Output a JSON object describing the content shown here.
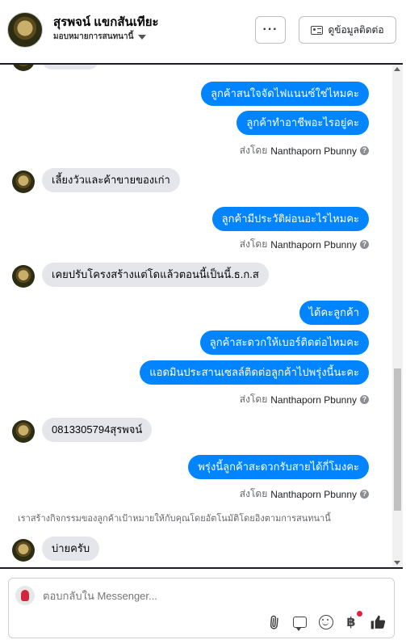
{
  "header": {
    "contact_name": "สุรพจน์ แขกสันเทียะ",
    "assign_label": "มอบหมายการสนทนานี้",
    "more_label": "···",
    "contact_info_label": "ดูข้อมูลติดต่อ"
  },
  "messages": {
    "out_1": "ลูกค้าสนใจจัดไฟแนนซ์ใช่ไหมคะ",
    "out_2": "ลูกค้าทำอาชีพอะไรอยู่คะ",
    "sent_1_prefix": "ส่งโดย",
    "sent_1_name": "Nanthaporn Pbunny",
    "in_1": "เลี้ยงวัวและค้าขายของเก่า",
    "out_3": "ลูกค้ามีประวัติผ่อนอะไรไหมคะ",
    "sent_2_prefix": "ส่งโดย",
    "sent_2_name": "Nanthaporn Pbunny",
    "in_2": "เคยปรับโครงสร้างแต่โดแล้วตอนนี้เป็นนี้.ธ.ก.ส",
    "out_4": "ได้คะลูกค้า",
    "out_5": "ลูกค้าสะดวกให้เบอร์ติดต่อไหมคะ",
    "out_6": "แอดมินประสานเซลล์ติดต่อลูกค้าไปพรุ่งนี้นะคะ",
    "sent_3_prefix": "ส่งโดย",
    "sent_3_name": "Nanthaporn Pbunny",
    "in_3": "0813305794สุรพจน์",
    "out_7": "พรุ่งนี้ลูกค้าสะดวกรับสายได้กี่โมงคะ",
    "sent_4_prefix": "ส่งโดย",
    "sent_4_name": "Nanthaporn Pbunny",
    "system_note": "เราสร้างกิจกรรมของลูกค้าเป้าหมายให้กับคุณโดยอัตโนมัติโดยอิงตามการสนทนานี้",
    "in_4": "บ่ายครับ"
  },
  "composer": {
    "placeholder": "ตอบกลับใน Messenger..."
  },
  "icons": {
    "info": "info-icon",
    "attach": "paperclip-icon",
    "saved_reply": "speech-bubble-icon",
    "emoji": "emoji-icon",
    "payment": "baht-icon",
    "like": "thumbs-up-icon"
  },
  "colors": {
    "outgoing_bubble": "#0084ff",
    "incoming_bubble": "#e4e6eb",
    "notification_dot": "#e41e3f"
  }
}
